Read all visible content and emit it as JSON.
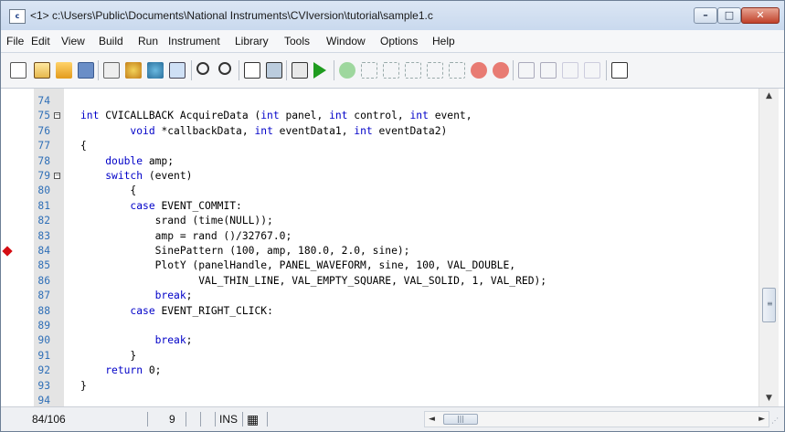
{
  "window": {
    "title": "<1> c:\\Users\\Public\\Documents\\National Instruments\\CVIversion\\tutorial\\sample1.c",
    "app_icon_text": "c",
    "minimize_glyph": "–",
    "maximize_glyph": "□",
    "close_glyph": "✕"
  },
  "menu": {
    "items": [
      {
        "label": "File"
      },
      {
        "label": "Edit"
      },
      {
        "label": "View"
      },
      {
        "label": "Build"
      },
      {
        "label": "Run"
      },
      {
        "label": "Instrument"
      },
      {
        "label": "Library"
      },
      {
        "label": "Tools"
      },
      {
        "label": "Window"
      },
      {
        "label": "Options"
      },
      {
        "label": "Help"
      }
    ]
  },
  "toolbar": {
    "icons": [
      "workspace-icon",
      "open-icon",
      "folder-icon",
      "save-icon",
      "build-icon",
      "compile-icon",
      "debug-icon",
      "panel-icon",
      "find-icon",
      "find-replace-icon",
      "waveform-icon",
      "panel-edit-icon",
      "run-target-icon",
      "run-icon",
      "go-icon",
      "step-into-icon",
      "step-over-icon",
      "step-out-icon",
      "run-to-cursor-icon",
      "finish-icon",
      "stop-icon",
      "breakpoint-icon",
      "toggle-bookmark-icon",
      "next-bookmark-icon",
      "watch-icon",
      "expression-icon",
      "memory-icon"
    ],
    "colors": {
      "run_green": "#1f9c1f",
      "stop_red": "#d8423a",
      "go_green": "#3cb043"
    }
  },
  "editor": {
    "lines": [
      {
        "no": "74",
        "code": ""
      },
      {
        "no": "75",
        "code": "int CVICALLBACK AcquireData (int panel, int control, int event,",
        "fold": "⊟"
      },
      {
        "no": "76",
        "code": "        void *callbackData, int eventData1, int eventData2)"
      },
      {
        "no": "77",
        "code": "{"
      },
      {
        "no": "78",
        "code": "    double amp;"
      },
      {
        "no": "79",
        "code": "    switch (event)",
        "fold": "⊟"
      },
      {
        "no": "80",
        "code": "        {"
      },
      {
        "no": "81",
        "code": "        case EVENT_COMMIT:"
      },
      {
        "no": "82",
        "code": "            srand (time(NULL));"
      },
      {
        "no": "83",
        "code": "            amp = rand ()/32767.0;"
      },
      {
        "no": "84",
        "code": "            SinePattern (100, amp, 180.0, 2.0, sine);",
        "breakpoint": true
      },
      {
        "no": "85",
        "code": "            PlotY (panelHandle, PANEL_WAVEFORM, sine, 100, VAL_DOUBLE,"
      },
      {
        "no": "86",
        "code": "                   VAL_THIN_LINE, VAL_EMPTY_SQUARE, VAL_SOLID, 1, VAL_RED);"
      },
      {
        "no": "87",
        "code": "            break;"
      },
      {
        "no": "88",
        "code": "        case EVENT_RIGHT_CLICK:"
      },
      {
        "no": "89",
        "code": ""
      },
      {
        "no": "90",
        "code": "            break;"
      },
      {
        "no": "91",
        "code": "        }"
      },
      {
        "no": "92",
        "code": "    return 0;"
      },
      {
        "no": "93",
        "code": "}"
      },
      {
        "no": "94",
        "code": ""
      }
    ],
    "breakpoint_color": "#d50d13",
    "line_number_color": "#2f6fb7",
    "keyword_color": "#0000c8"
  },
  "scroll": {
    "vertical_position": 0.73,
    "up_arrow": "▲",
    "down_arrow": "▼",
    "left_arrow": "◄",
    "right_arrow": "►",
    "grip": "≡",
    "hgrip": "|||"
  },
  "status": {
    "position": "84/106",
    "column": "9",
    "mode": "INS",
    "keyboard_icon": "▦"
  }
}
